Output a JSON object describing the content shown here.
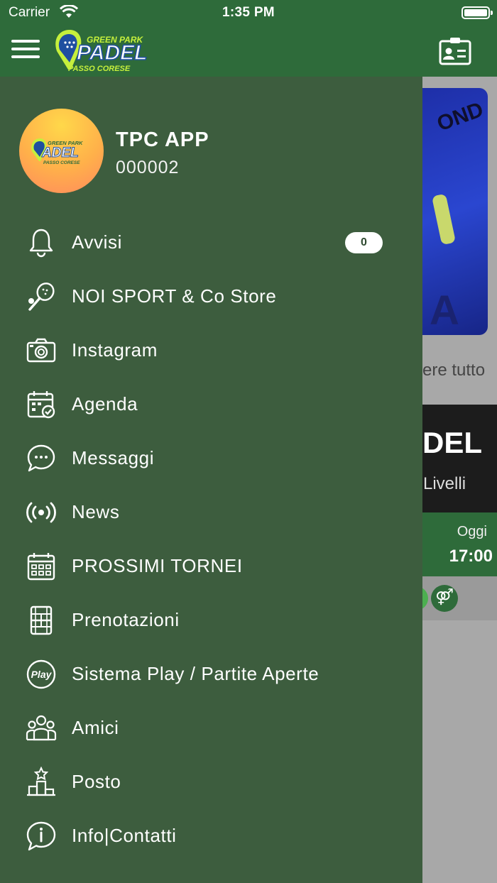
{
  "status_bar": {
    "carrier": "Carrier",
    "time": "1:35 PM"
  },
  "header": {
    "logo_text_top": "GREEN PARK",
    "logo_text_main": "PADEL",
    "logo_text_bottom": "PASSO CORESE"
  },
  "profile": {
    "name": "TPC  APP",
    "code": "000002"
  },
  "menu": [
    {
      "label": "Avvisi",
      "icon": "bell-icon",
      "badge": "0"
    },
    {
      "label": "NOI SPORT & Co Store",
      "icon": "padel-racket-icon"
    },
    {
      "label": "Instagram",
      "icon": "camera-icon"
    },
    {
      "label": "Agenda",
      "icon": "calendar-check-icon"
    },
    {
      "label": "Messaggi",
      "icon": "chat-bubble-icon"
    },
    {
      "label": "News",
      "icon": "broadcast-icon"
    },
    {
      "label": "PROSSIMI TORNEI",
      "icon": "calendar-grid-icon"
    },
    {
      "label": "Prenotazioni",
      "icon": "court-icon"
    },
    {
      "label": "Sistema Play / Partite Aperte",
      "icon": "play-logo-icon"
    },
    {
      "label": "Amici",
      "icon": "friends-icon"
    },
    {
      "label": "Posto",
      "icon": "podium-icon"
    },
    {
      "label": "Info|Contatti",
      "icon": "info-bubble-icon"
    }
  ],
  "background": {
    "vedi_tutto": "ere tutto",
    "card_title": "DEL",
    "card_subtitle": "Livelli",
    "card_day": "Oggi",
    "card_time": "17:00"
  },
  "colors": {
    "header": "#2e6b3a",
    "drawer": "#3d5d3e",
    "accent": "#c6f03c"
  }
}
